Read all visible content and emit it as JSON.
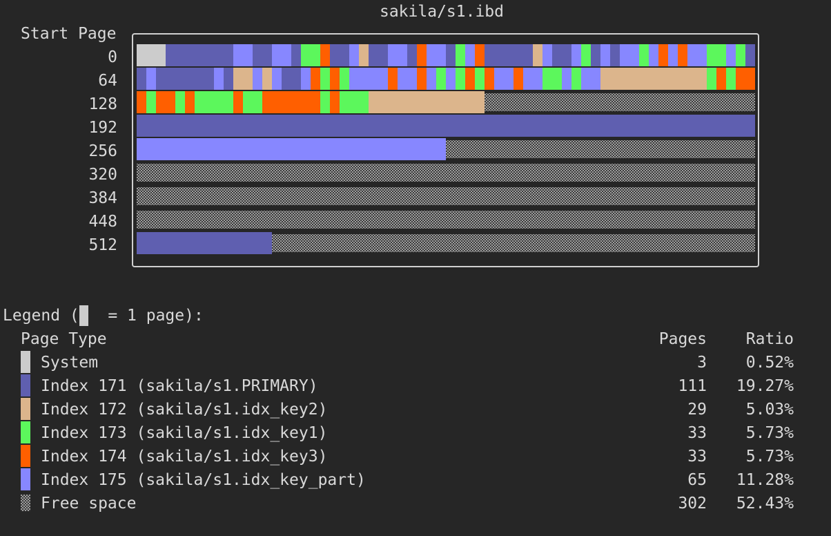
{
  "window": {
    "title": "sakila/s1.ibd"
  },
  "map": {
    "start_page_header": "Start Page",
    "row_labels": [
      "0",
      "64",
      "128",
      "192",
      "256",
      "320",
      "384",
      "448",
      "512"
    ],
    "pages_per_row": 64
  },
  "legend": {
    "title_before": "Legend (",
    "title_after": " = 1 page):",
    "headers": {
      "type": "Page Type",
      "pages": "Pages",
      "ratio": "Ratio"
    },
    "rows": [
      {
        "key": "system",
        "label": "System",
        "pages": "3",
        "ratio": "0.52%",
        "color": "#cccccc"
      },
      {
        "key": "idx171",
        "label": "Index 171 (sakila/s1.PRIMARY)",
        "pages": "111",
        "ratio": "19.27%",
        "color": "#5f5fb0"
      },
      {
        "key": "idx172",
        "label": "Index 172 (sakila/s1.idx_key2)",
        "pages": "29",
        "ratio": "5.03%",
        "color": "#dcb58c"
      },
      {
        "key": "idx173",
        "label": "Index 173 (sakila/s1.idx_key1)",
        "pages": "33",
        "ratio": "5.73%",
        "color": "#5cf75c"
      },
      {
        "key": "idx174",
        "label": "Index 174 (sakila/s1.idx_key3)",
        "pages": "33",
        "ratio": "5.73%",
        "color": "#ff5f00"
      },
      {
        "key": "idx175",
        "label": "Index 175 (sakila/s1.idx_key_part)",
        "pages": "65",
        "ratio": "11.28%",
        "color": "#8787ff"
      },
      {
        "key": "free",
        "label": "Free space",
        "pages": "302",
        "ratio": "52.43%",
        "color": "#9e9e9e"
      }
    ]
  }
}
